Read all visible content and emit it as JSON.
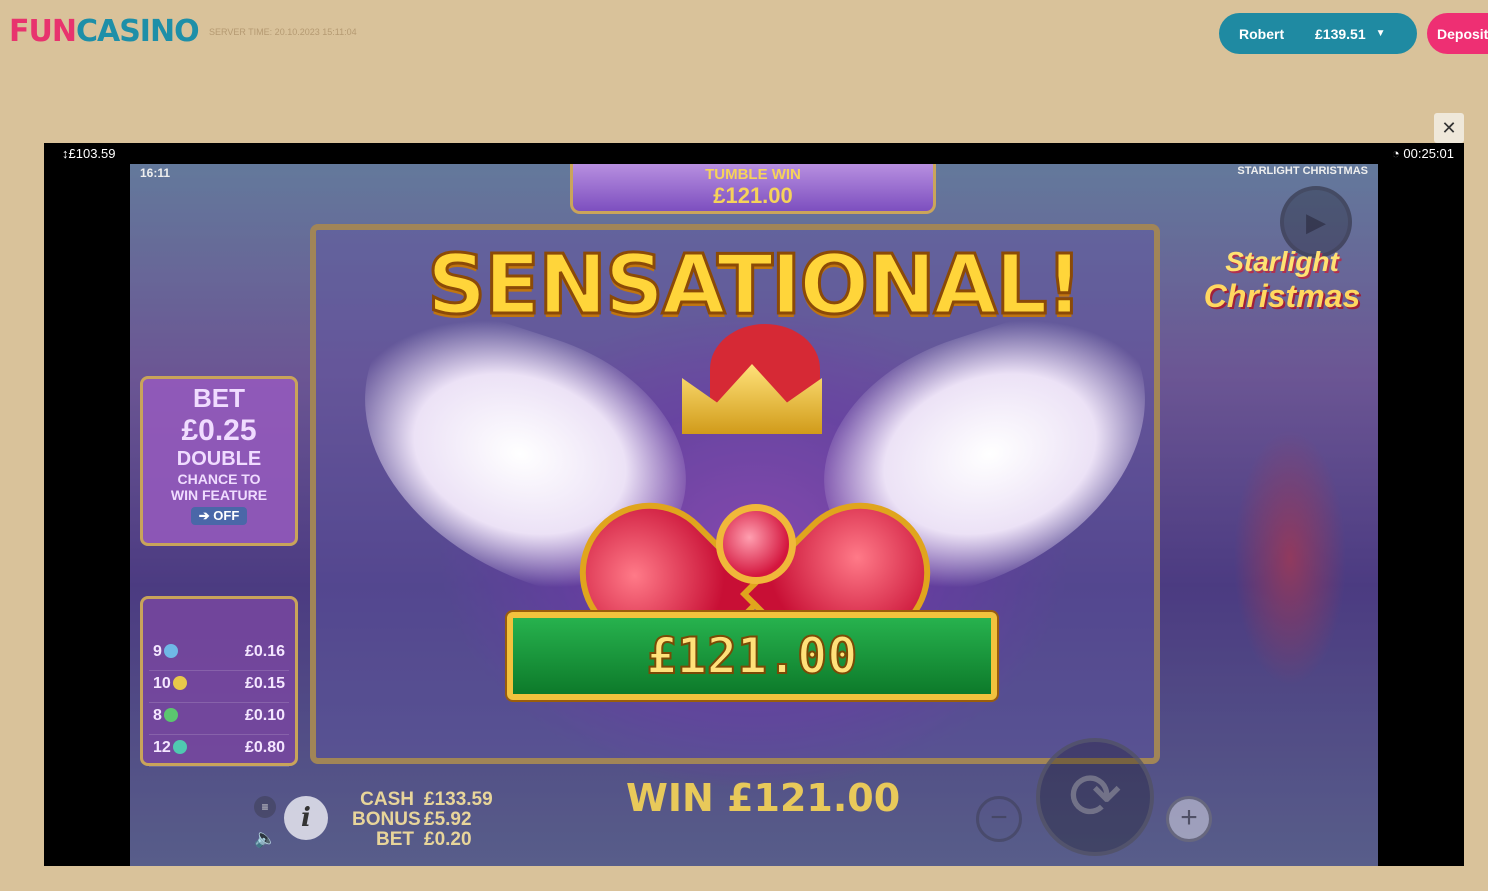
{
  "header": {
    "logo_fun": "FUN",
    "logo_casino": "CASINO",
    "server_time": "SERVER TIME: 20.10.2023 15:11:04",
    "username": "Robert",
    "balance": "£139.51",
    "deposit_label": "Deposit"
  },
  "frame": {
    "close_label": "✕",
    "balance": "£103.59",
    "timer": "00:25:01"
  },
  "game": {
    "clock": "16:11",
    "title_small": "STARLIGHT CHRISTMAS",
    "tumble_label": "TUMBLE WIN",
    "tumble_value": "£121.00",
    "logo_line1": "Starlight",
    "logo_line2": "Christmas",
    "bet_panel": {
      "label": "BET",
      "value": "£0.25",
      "line1": "DOUBLE",
      "line2": "CHANCE TO",
      "line3": "WIN FEATURE",
      "toggle": "OFF"
    },
    "paytable": [
      {
        "count": "9",
        "amount": "£0.16"
      },
      {
        "count": "10",
        "amount": "£0.15"
      },
      {
        "count": "8",
        "amount": "£0.10"
      },
      {
        "count": "12",
        "amount": "£0.80"
      }
    ],
    "big_win_title": "SENSATIONAL!",
    "big_win_amount": "£121.00",
    "cash_label": "CASH",
    "cash_value": "£133.59",
    "bonus_label": "BONUS",
    "bonus_value": "£5.92",
    "bet_label": "BET",
    "bet_value": "£0.20",
    "win_total": "WIN £121.00"
  },
  "icons": {
    "menu": "≡",
    "info": "i",
    "sound": "🔈",
    "minus": "−",
    "plus": "+",
    "spin": "⟳",
    "autoplay": "▶"
  }
}
